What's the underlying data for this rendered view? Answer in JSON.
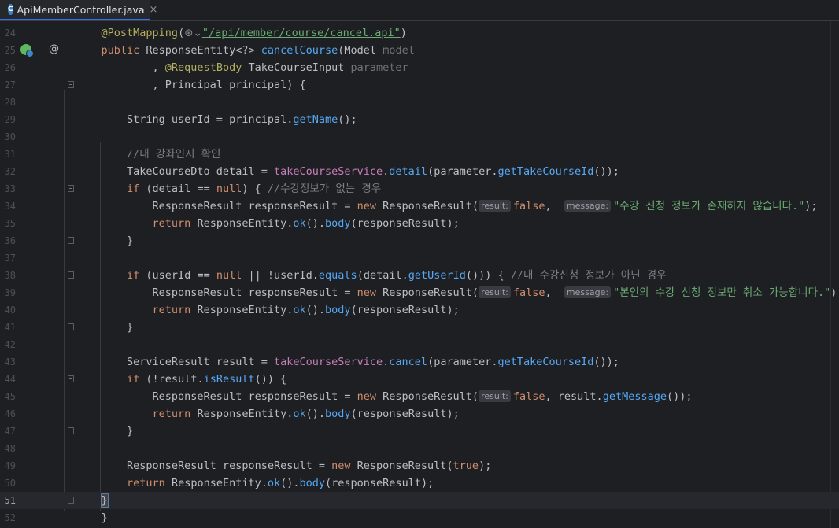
{
  "tab": {
    "icon_letter": "C",
    "label": "ApiMemberController.java",
    "close_glyph": "×"
  },
  "colors": {
    "background": "#1e1f22",
    "keyword": "#cf8e6d",
    "method": "#56a8f5",
    "string": "#6aab73",
    "comment": "#7a7e85",
    "field": "#c77dbb",
    "annotation": "#b3ae60",
    "accent": "#3574f0"
  },
  "gutter_icons": {
    "line25_left": "spring-bean-icon",
    "line25_right": "@"
  },
  "lines": [
    {
      "num": "24",
      "html": "<span class='ann'>@PostMapping</span>(<span class='gicon' style='position:static;color:#8a8d93'>⊛⌄</span><span class='url'>\"/api/member/course/cancel.api\"</span>)"
    },
    {
      "num": "25",
      "html": "<span class='kw'>public</span> ResponseEntity&lt;?&gt; <span class='mth'>cancelCourse</span>(Model <span class='unused'>model</span>"
    },
    {
      "num": "26",
      "html": "        , <span class='ann'>@RequestBody</span> TakeCourseInput <span class='unused'>parameter</span>"
    },
    {
      "num": "27",
      "html": "        , Principal principal) {"
    },
    {
      "num": "28",
      "html": ""
    },
    {
      "num": "29",
      "html": "    String userId = principal.<span class='mth'>getName</span>();"
    },
    {
      "num": "30",
      "html": ""
    },
    {
      "num": "31",
      "html": "    <span class='cmt'>//내 강좌인지 확인</span>"
    },
    {
      "num": "32",
      "html": "    TakeCourseDto detail = <span class='fld'>takeCourseService</span>.<span class='mth'>detail</span>(parameter.<span class='mth'>getTakeCourseId</span>());"
    },
    {
      "num": "33",
      "html": "    <span class='kw'>if</span> (detail == <span class='kw'>null</span>) { <span class='cmt'>//수강정보가 없는 경우</span>"
    },
    {
      "num": "34",
      "html": "        ResponseResult responseResult = <span class='kw'>new</span> ResponseResult(<span class='hint'>result:</span><span class='kw'>false</span>,  <span class='hint'>message:</span><span class='str'>\"수강 신청 정보가 존재하지 않습니다.\"</span>);"
    },
    {
      "num": "35",
      "html": "        <span class='kw'>return</span> ResponseEntity.<span class='mth'>ok</span>().<span class='mth'>body</span>(responseResult);"
    },
    {
      "num": "36",
      "html": "    }"
    },
    {
      "num": "37",
      "html": ""
    },
    {
      "num": "38",
      "html": "    <span class='kw'>if</span> (userId == <span class='kw'>null</span> || !userId.<span class='mth'>equals</span>(detail.<span class='mth'>getUserId</span>())) { <span class='cmt'>//내 수강신청 정보가 아닌 경우</span>"
    },
    {
      "num": "39",
      "html": "        ResponseResult responseResult = <span class='kw'>new</span> ResponseResult(<span class='hint'>result:</span><span class='kw'>false</span>,  <span class='hint'>message:</span><span class='str'>\"본인의 수강 신청 정보만 취소 가능합니다.\"</span>);"
    },
    {
      "num": "40",
      "html": "        <span class='kw'>return</span> ResponseEntity.<span class='mth'>ok</span>().<span class='mth'>body</span>(responseResult);"
    },
    {
      "num": "41",
      "html": "    }"
    },
    {
      "num": "42",
      "html": ""
    },
    {
      "num": "43",
      "html": "    ServiceResult result = <span class='fld'>takeCourseService</span>.<span class='mth'>cancel</span>(parameter.<span class='mth'>getTakeCourseId</span>());"
    },
    {
      "num": "44",
      "html": "    <span class='kw'>if</span> (!result.<span class='mth'>isResult</span>()) {"
    },
    {
      "num": "45",
      "html": "        ResponseResult responseResult = <span class='kw'>new</span> ResponseResult(<span class='hint'>result:</span><span class='kw'>false</span>, result.<span class='mth'>getMessage</span>());"
    },
    {
      "num": "46",
      "html": "        <span class='kw'>return</span> ResponseEntity.<span class='mth'>ok</span>().<span class='mth'>body</span>(responseResult);"
    },
    {
      "num": "47",
      "html": "    }"
    },
    {
      "num": "48",
      "html": ""
    },
    {
      "num": "49",
      "html": "    ResponseResult responseResult = <span class='kw'>new</span> ResponseResult(<span class='kw'>true</span>);"
    },
    {
      "num": "50",
      "html": "    <span class='kw'>return</span> ResponseEntity.<span class='mth'>ok</span>().<span class='mth'>body</span>(responseResult);"
    },
    {
      "num": "51",
      "html": "<span class='brace-hl'>}</span>",
      "current": true
    },
    {
      "num": "52",
      "html": "}"
    }
  ]
}
